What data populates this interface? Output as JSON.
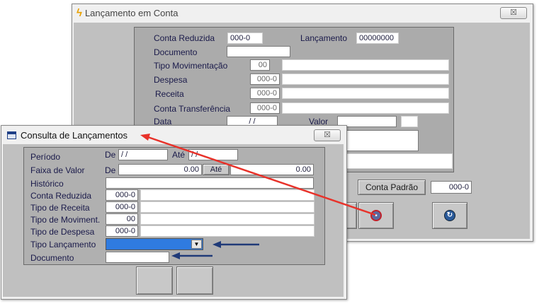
{
  "back_window": {
    "title": "Lançamento em Conta",
    "title_icon": "lightning-icon",
    "close_label": "☒",
    "fields": {
      "conta_reduzida_label": "Conta Reduzida",
      "conta_reduzida_value": "000-0",
      "lancamento_label": "Lançamento",
      "lancamento_value": "00000000",
      "documento_label": "Documento",
      "tipo_mov_label": "Tipo Movimentação",
      "tipo_mov_value": "00",
      "despesa_label": "Despesa",
      "despesa_value": "000-0",
      "receita_label": "Receita",
      "receita_value": "000-0",
      "conta_transf_label": "Conta Transferência",
      "conta_transf_value": "000-0",
      "data_label": "Data",
      "data_value": "/ /",
      "valor_label": "Valor"
    },
    "conta_padrao_label": "Conta Padrão",
    "conta_padrao_value": "000-0"
  },
  "front_window": {
    "title": "Consulta de Lançamentos",
    "title_icon": "grid-window-icon",
    "close_label": "☒",
    "periodo_label": "Período",
    "de_label": "De",
    "ate_label": "Até",
    "periodo_de": "/ /",
    "periodo_ate": "/ /",
    "faixa_label": "Faixa de Valor",
    "faixa_de": "0.00",
    "faixa_ate": "0.00",
    "historico_label": "Histórico",
    "conta_reduzida_label": "Conta Reduzida",
    "conta_reduzida_value": "000-0",
    "tipo_receita_label": "Tipo de Receita",
    "tipo_receita_value": "000-0",
    "tipo_moviment_label": "Tipo de Moviment.",
    "tipo_moviment_value": "00",
    "tipo_despesa_label": "Tipo de Despesa",
    "tipo_despesa_value": "000-0",
    "tipo_lancamento_label": "Tipo Lançamento",
    "documento_label": "Documento"
  },
  "colors": {
    "red_arrow": "#e8322a",
    "blue_arrow": "#1f3a78",
    "select_highlight": "#2f7be0"
  }
}
